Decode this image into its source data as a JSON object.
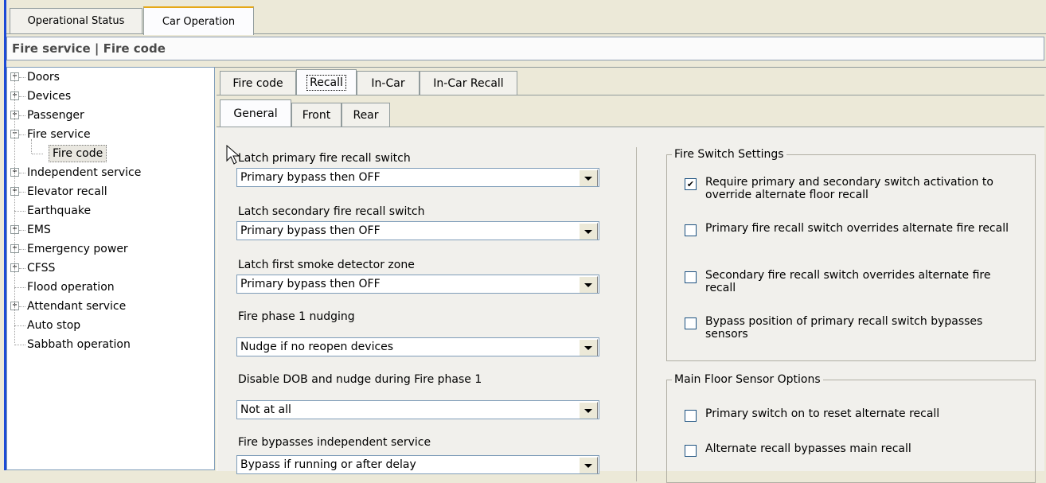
{
  "top_tabs": [
    "Operational Status",
    "Car Operation"
  ],
  "section_header": "Fire service | Fire code",
  "tree": [
    {
      "label": "Doors",
      "expander": "+"
    },
    {
      "label": "Devices",
      "expander": "+"
    },
    {
      "label": "Passenger",
      "expander": "+"
    },
    {
      "label": "Fire service",
      "expander": "−"
    },
    {
      "label": "Fire code",
      "expander": ""
    },
    {
      "label": "Independent service",
      "expander": "+"
    },
    {
      "label": "Elevator recall",
      "expander": "+"
    },
    {
      "label": "Earthquake",
      "expander": ""
    },
    {
      "label": "EMS",
      "expander": "+"
    },
    {
      "label": "Emergency power",
      "expander": "+"
    },
    {
      "label": "CFSS",
      "expander": "+"
    },
    {
      "label": "Flood operation",
      "expander": ""
    },
    {
      "label": "Attendant service",
      "expander": "+"
    },
    {
      "label": "Auto stop",
      "expander": ""
    },
    {
      "label": "Sabbath operation",
      "expander": ""
    }
  ],
  "sub_tabs": [
    "Fire code",
    "Recall",
    "In-Car",
    "In-Car Recall"
  ],
  "group_tabs": [
    "General",
    "Front",
    "Rear"
  ],
  "fields": [
    {
      "label": "Latch primary fire recall switch",
      "value": "Primary bypass then OFF"
    },
    {
      "label": "Latch secondary fire recall switch",
      "value": "Primary bypass then OFF"
    },
    {
      "label": "Latch first smoke detector zone",
      "value": "Primary bypass then OFF"
    },
    {
      "label": "Fire phase 1 nudging",
      "value": "Nudge if no reopen devices"
    },
    {
      "label": "Disable DOB and nudge during Fire phase 1",
      "value": "Not at all"
    },
    {
      "label": "Fire bypasses independent service",
      "value": "Bypass if running or after delay"
    }
  ],
  "fire_switch_settings": {
    "title": "Fire Switch Settings",
    "items": [
      {
        "text": "Require primary and secondary switch activation to override alternate floor recall",
        "checked": "✔"
      },
      {
        "text": "Primary fire recall switch overrides alternate fire recall",
        "checked": ""
      },
      {
        "text": "Secondary fire recall switch overrides alternate fire recall",
        "checked": ""
      },
      {
        "text": "Bypass position of primary recall switch bypasses sensors",
        "checked": ""
      }
    ]
  },
  "main_floor_sensor_options": {
    "title": "Main Floor Sensor Options",
    "items": [
      {
        "text": "Primary switch on to reset alternate recall",
        "checked": ""
      },
      {
        "text": "Alternate recall bypasses main recall",
        "checked": ""
      }
    ]
  }
}
